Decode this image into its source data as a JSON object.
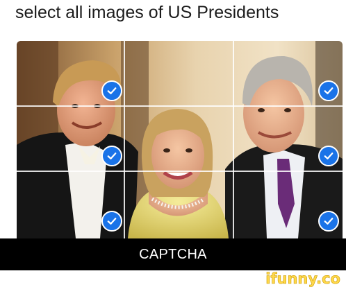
{
  "prompt": {
    "text": "select all images of US Presidents"
  },
  "captcha": {
    "grid_rows": 3,
    "grid_cols": 3,
    "selected_tiles": [
      {
        "row": 1,
        "col": 1
      },
      {
        "row": 2,
        "col": 1
      },
      {
        "row": 3,
        "col": 1
      },
      {
        "row": 1,
        "col": 3
      },
      {
        "row": 2,
        "col": 3
      },
      {
        "row": 3,
        "col": 3
      }
    ],
    "check_color": "#1a73e8",
    "check_icon": "checkmark-icon"
  },
  "caption": {
    "text": "CAPTCHA"
  },
  "watermark": {
    "text": "ifunny.co",
    "color": "#ffd84a"
  }
}
